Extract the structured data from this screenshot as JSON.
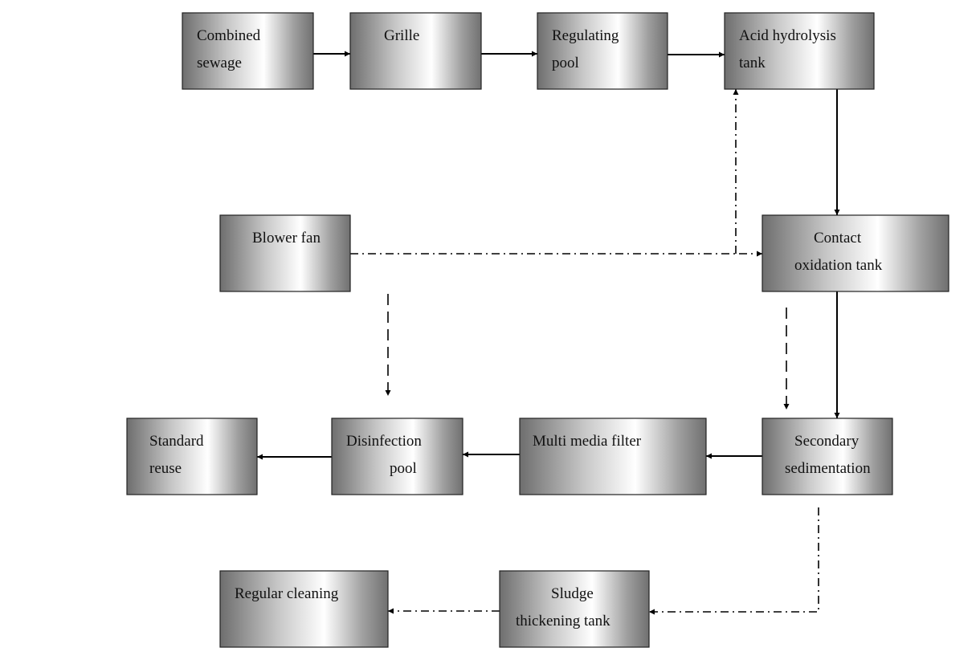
{
  "nodes": [
    {
      "id": "combined-sewage",
      "lines": [
        "Combined",
        "sewage"
      ]
    },
    {
      "id": "grille",
      "lines": [
        "Grille"
      ]
    },
    {
      "id": "regulating-pool",
      "lines": [
        "Regulating",
        "pool"
      ]
    },
    {
      "id": "acid-hydrolysis-tank",
      "lines": [
        "Acid  hydrolysis",
        "tank"
      ]
    },
    {
      "id": "blower-fan",
      "lines": [
        "Blower fan"
      ]
    },
    {
      "id": "contact-oxidation-tank",
      "lines": [
        "Contact",
        "oxidation tank"
      ]
    },
    {
      "id": "standard-reuse",
      "lines": [
        "Standard",
        "reuse"
      ]
    },
    {
      "id": "disinfection-pool",
      "lines": [
        "Disinfection",
        "pool"
      ]
    },
    {
      "id": "multi-media-filter",
      "lines": [
        "Multi media filter"
      ]
    },
    {
      "id": "secondary-sedimentation",
      "lines": [
        "Secondary",
        "sedimentation"
      ]
    },
    {
      "id": "regular-cleaning",
      "lines": [
        "Regular cleaning"
      ]
    },
    {
      "id": "sludge-thickening-tank",
      "lines": [
        "Sludge",
        "thickening tank"
      ]
    }
  ],
  "edges": [
    {
      "from": "combined-sewage",
      "to": "grille",
      "style": "solid"
    },
    {
      "from": "grille",
      "to": "regulating-pool",
      "style": "solid"
    },
    {
      "from": "regulating-pool",
      "to": "acid-hydrolysis-tank",
      "style": "solid"
    },
    {
      "from": "acid-hydrolysis-tank",
      "to": "contact-oxidation-tank",
      "style": "solid"
    },
    {
      "from": "contact-oxidation-tank",
      "to": "secondary-sedimentation",
      "style": "solid"
    },
    {
      "from": "secondary-sedimentation",
      "to": "multi-media-filter",
      "style": "solid"
    },
    {
      "from": "multi-media-filter",
      "to": "disinfection-pool",
      "style": "solid"
    },
    {
      "from": "disinfection-pool",
      "to": "standard-reuse",
      "style": "solid"
    },
    {
      "from": "blower-fan",
      "to": "contact-oxidation-tank",
      "style": "dash-dot"
    },
    {
      "from": "blower-fan",
      "to": "acid-hydrolysis-tank",
      "style": "dash-dot"
    },
    {
      "from": "secondary-sedimentation",
      "to": "sludge-thickening-tank",
      "style": "dash-dot"
    },
    {
      "from": "sludge-thickening-tank",
      "to": "regular-cleaning",
      "style": "dash-dot"
    },
    {
      "from": "blower-fan",
      "to": "disinfection-pool",
      "style": "dashed"
    },
    {
      "from": "contact-oxidation-tank",
      "to": "secondary-sedimentation",
      "style": "dashed"
    }
  ],
  "colors": {
    "box_dark": "#6e6e6e",
    "box_light": "#ffffff",
    "line": "#000000"
  }
}
